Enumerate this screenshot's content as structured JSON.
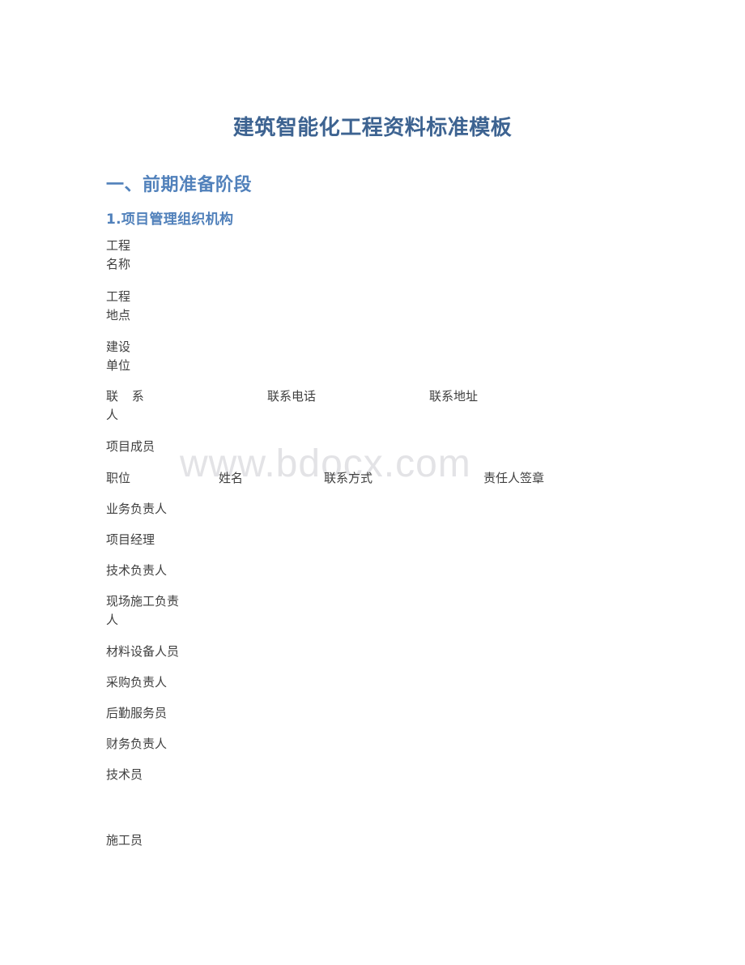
{
  "document": {
    "title": "建筑智能化工程资料标准模板",
    "watermark": "www.bdocx.com"
  },
  "headings": {
    "section": "一、前期准备阶段",
    "subsection": "1.项目管理组织机构"
  },
  "project_info": {
    "rows": [
      {
        "label": "工程\n名称",
        "value": ""
      },
      {
        "label": "工程\n地点",
        "value": ""
      },
      {
        "label": "建设\n单位",
        "value": ""
      }
    ],
    "contact_row": {
      "contact_person_label": "联 系\n人",
      "contact_person_value": "",
      "phone_label": "联系电话",
      "phone_value": "",
      "address_label": "联系地址",
      "address_value": ""
    }
  },
  "members": {
    "title": "项目成员",
    "columns": [
      "职位",
      "姓名",
      "联系方式",
      "责任人签章"
    ],
    "rows": [
      {
        "position": "业务负责人",
        "name": "",
        "contact": "",
        "signature": ""
      },
      {
        "position": "项目经理",
        "name": "",
        "contact": "",
        "signature": ""
      },
      {
        "position": "技术负责人",
        "name": "",
        "contact": "",
        "signature": ""
      },
      {
        "position": "现场施工负责\n人",
        "name": "",
        "contact": "",
        "signature": ""
      },
      {
        "position": "材料设备人员",
        "name": "",
        "contact": "",
        "signature": ""
      },
      {
        "position": "采购负责人",
        "name": "",
        "contact": "",
        "signature": ""
      },
      {
        "position": "后勤服务员",
        "name": "",
        "contact": "",
        "signature": ""
      },
      {
        "position": "财务负责人",
        "name": "",
        "contact": "",
        "signature": ""
      },
      {
        "position": "技术员",
        "name": "",
        "contact": "",
        "signature": ""
      },
      {
        "position": "",
        "name": "",
        "contact": "",
        "signature": ""
      },
      {
        "position": "施工员",
        "name": "",
        "contact": "",
        "signature": ""
      }
    ]
  },
  "colors": {
    "title_blue": "#3d6391",
    "heading_blue": "#5181bb",
    "body_text": "#3f3f3f",
    "watermark_gray": "#e3e3e6",
    "page_background": "#ffffff"
  }
}
